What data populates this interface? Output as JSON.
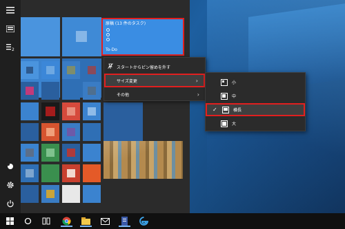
{
  "desktop": {
    "wallpaper": "windows-10-blue-light"
  },
  "start_menu": {
    "rail_icons": [
      "hamburger-icon",
      "all-apps-icon",
      "sort-icon",
      "user-icon",
      "settings-icon",
      "power-icon"
    ],
    "todo_tile": {
      "title": "原稿 (13 件のタスク)",
      "name": "To-Do",
      "color": "#3a8de3"
    }
  },
  "context_menu": {
    "items": [
      {
        "label": "スタートからピン留めを外す",
        "icon": "unpin-icon"
      },
      {
        "label": "サイズ変更",
        "has_submenu": true,
        "highlighted": true
      },
      {
        "label": "その他",
        "has_submenu": true
      }
    ]
  },
  "size_submenu": {
    "items": [
      {
        "label": "小",
        "checked": false
      },
      {
        "label": "中",
        "checked": false
      },
      {
        "label": "横長",
        "checked": true,
        "highlighted": true
      },
      {
        "label": "大",
        "checked": false
      }
    ]
  },
  "taskbar": {
    "icons": [
      "windows-start-icon",
      "search-icon",
      "task-view-icon",
      "chrome-icon",
      "file-explorer-icon",
      "mail-icon",
      "document-icon",
      "edge-icon"
    ]
  },
  "colors": {
    "highlight_border": "#e21f1f",
    "accent": "#3a8de3"
  }
}
